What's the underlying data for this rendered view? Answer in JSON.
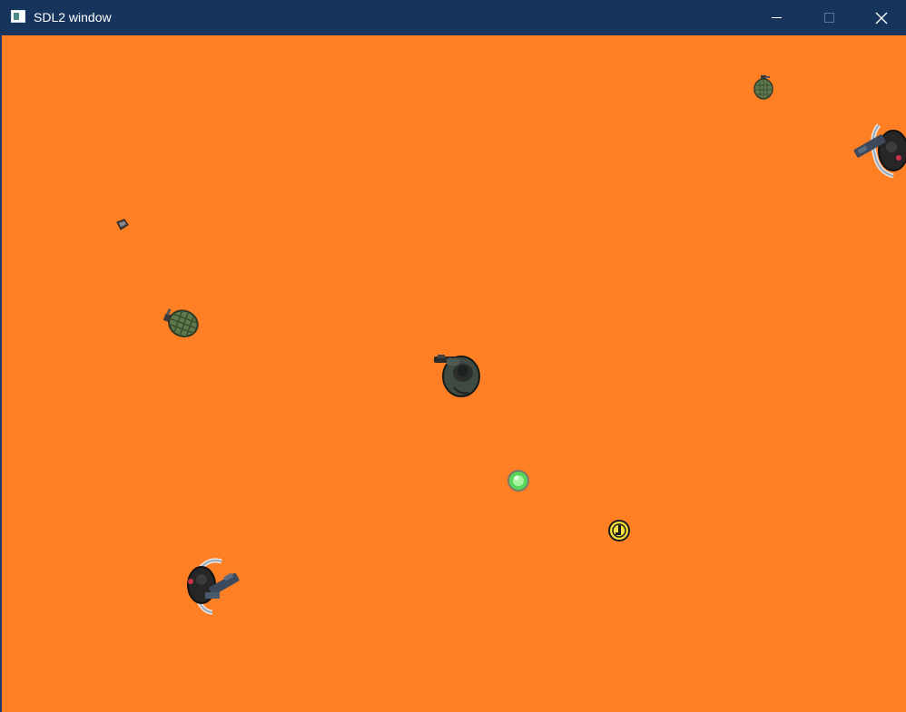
{
  "window": {
    "title": "SDL2 window",
    "controls": [
      "minimize",
      "maximize",
      "close"
    ]
  },
  "colors": {
    "titlebar": "#17345C",
    "ground": "#FF7F24"
  },
  "sprites": [
    {
      "name": "player-soldier",
      "icon": "soldier-icon"
    },
    {
      "name": "enemy-robot-upper-right",
      "icon": "robot-gunner-icon"
    },
    {
      "name": "enemy-robot-lower-left",
      "icon": "robot-gunner-icon"
    },
    {
      "name": "grenade-large",
      "icon": "grenade-icon"
    },
    {
      "name": "grenade-small",
      "icon": "grenade-icon"
    },
    {
      "name": "ammo-clip",
      "icon": "ammo-icon"
    },
    {
      "name": "health-orb",
      "icon": "green-orb-icon"
    },
    {
      "name": "gold-coin",
      "icon": "coin-icon"
    }
  ]
}
